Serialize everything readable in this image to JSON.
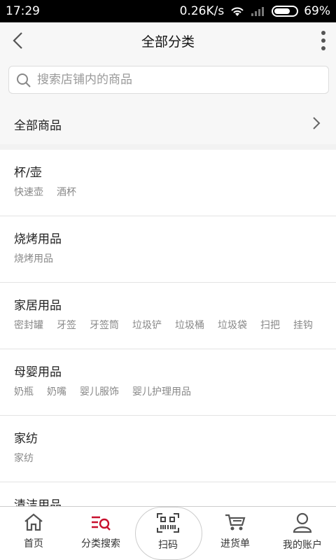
{
  "status": {
    "time": "17:29",
    "speed": "0.26K/s",
    "battery": "69%"
  },
  "header": {
    "title": "全部分类"
  },
  "search": {
    "placeholder": "搜索店铺内的商品"
  },
  "all_products": {
    "label": "全部商品"
  },
  "categories": [
    {
      "name": "杯/壶",
      "subs": [
        "快速壶",
        "酒杯"
      ]
    },
    {
      "name": "烧烤用品",
      "subs": [
        "烧烤用品"
      ]
    },
    {
      "name": "家居用品",
      "subs": [
        "密封罐",
        "牙签",
        "牙签筒",
        "垃圾铲",
        "垃圾桶",
        "垃圾袋",
        "扫把",
        "挂钩"
      ]
    },
    {
      "name": "母婴用品",
      "subs": [
        "奶瓶",
        "奶嘴",
        "婴儿服饰",
        "婴儿护理用品"
      ]
    },
    {
      "name": "家纺",
      "subs": [
        "家纺"
      ]
    },
    {
      "name": "清洁用品",
      "subs": []
    }
  ],
  "tabs": [
    {
      "label": "首页",
      "icon": "home-icon"
    },
    {
      "label": "分类搜索",
      "icon": "category-search-icon"
    },
    {
      "label": "扫码",
      "icon": "barcode-scan-icon"
    },
    {
      "label": "进货单",
      "icon": "cart-icon"
    },
    {
      "label": "我的账户",
      "icon": "user-icon"
    }
  ],
  "colors": {
    "accent": "#c8102e"
  }
}
